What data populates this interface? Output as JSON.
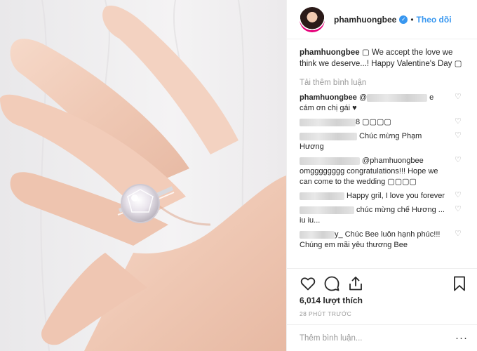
{
  "post": {
    "username": "phamhuongbee",
    "follow_label": "Theo dõi",
    "caption_user": "phamhuongbee",
    "caption_text": " ▢ We accept the love we think we deserve...! Happy Valentine's Day ▢",
    "load_more": "Tải thêm bình luận",
    "likes": "6,014 lượt thích",
    "time": "28 PHÚT TRƯỚC",
    "add_comment_placeholder": "Thêm bình luận...",
    "more_label": "···"
  },
  "comments": [
    {
      "user": "phamhuongbee",
      "text_before": " @",
      "text_after": " e cám ơn chị gái ♥"
    },
    {
      "user": "",
      "text_before": "",
      "text_after": "8 ▢▢▢▢"
    },
    {
      "user": "",
      "text_before": "",
      "text_after": " Chúc mừng Phạm Hương"
    },
    {
      "user": "",
      "text_before": "",
      "text_after": " @phamhuongbee omgggggggg congratulations!!! Hope we can come to the wedding ▢▢▢▢"
    },
    {
      "user": "",
      "text_before": "",
      "text_after": " Happy gril, I love you forever"
    },
    {
      "user": "",
      "text_before": "",
      "text_after": " chúc mừng chế Hương ... iu iu..."
    },
    {
      "user": "",
      "text_before": "",
      "text_after": "y_ Chúc Bee luôn hạnh phúc!!! Chúng em mãi yêu thương Bee"
    }
  ],
  "icons": {
    "heart": "heart-outline-icon",
    "comment": "comment-bubble-icon",
    "share": "share-upload-icon",
    "bookmark": "bookmark-icon",
    "verified": "verified-badge-icon"
  },
  "colors": {
    "link": "#3897f0",
    "muted": "#999999",
    "text": "#262626",
    "border": "#efefef"
  }
}
